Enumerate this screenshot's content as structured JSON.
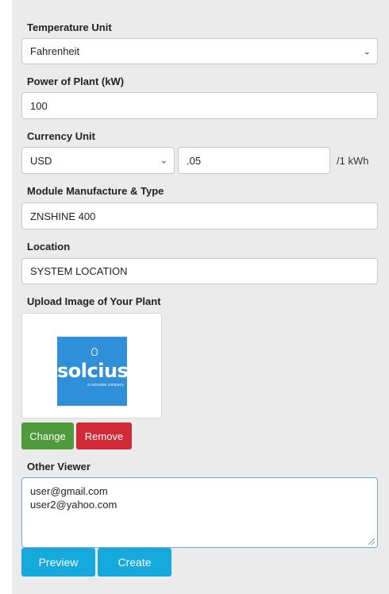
{
  "temperature": {
    "label": "Temperature Unit",
    "value": "Fahrenheit"
  },
  "power": {
    "label": "Power of Plant (kW)",
    "value": "100"
  },
  "currency": {
    "label": "Currency Unit",
    "unit_value": "USD",
    "rate_value": ".05",
    "rate_suffix": "/1 kWh"
  },
  "module": {
    "label": "Module Manufacture & Type",
    "value": "ZNSHINE 400"
  },
  "location": {
    "label": "Location",
    "value": "SYSTEM LOCATION"
  },
  "upload": {
    "label": "Upload Image of Your Plant",
    "logo_word": "solcius",
    "logo_tagline": "a sunvalue company",
    "change_label": "Change",
    "remove_label": "Remove"
  },
  "viewers": {
    "label": "Other Viewer",
    "lines": [
      "user@gmail.com",
      "user2@yahoo.com"
    ]
  },
  "actions": {
    "preview_label": "Preview",
    "create_label": "Create"
  },
  "colors": {
    "change_button": "#4f9a3a",
    "remove_button": "#cf2a36",
    "primary_button": "#16a9dc",
    "logo_background": "#2f8fd8"
  },
  "icons": {
    "select_arrow": "chevron-down-icon",
    "textarea_grip": "resize-grip-icon",
    "logo_bulb": "bulb-icon"
  }
}
